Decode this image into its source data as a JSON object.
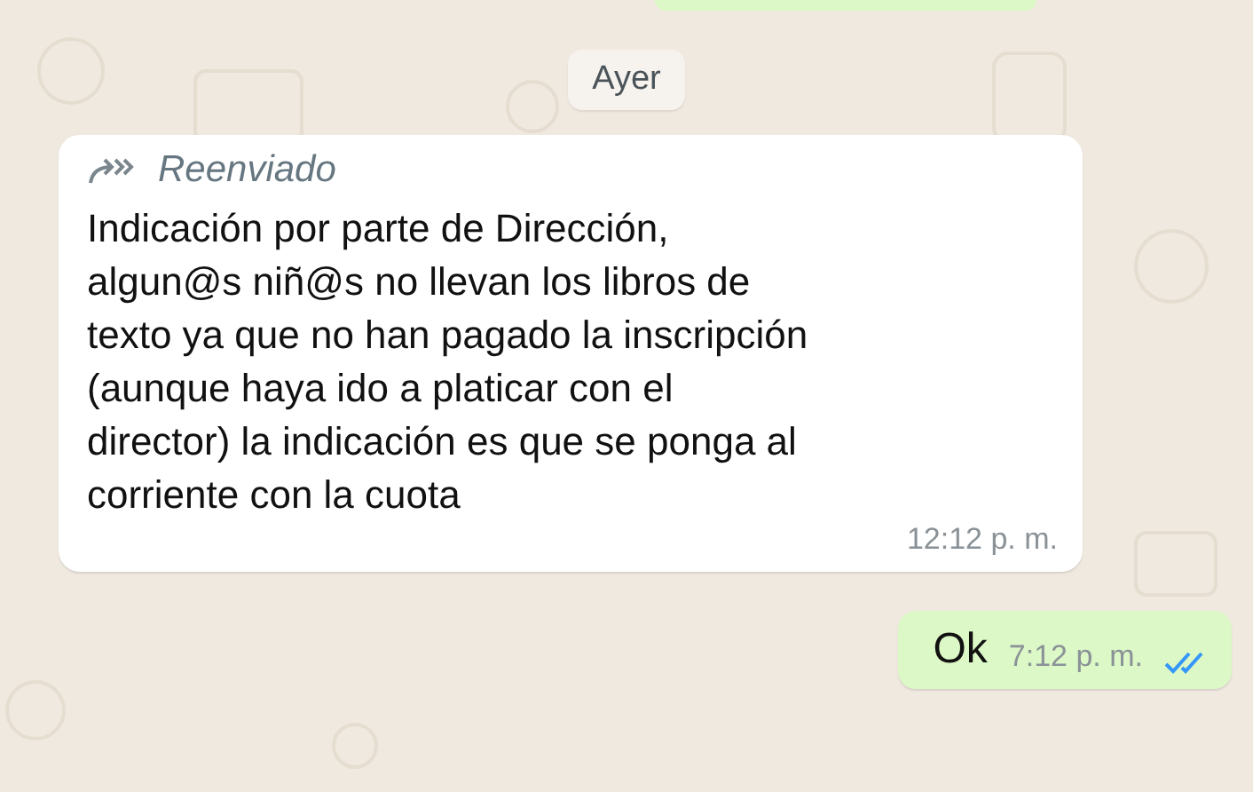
{
  "date_chip": "Ayer",
  "messages": [
    {
      "kind": "incoming",
      "forwarded": true,
      "forwarded_label": "Reenviado",
      "text_lines": [
        "Indicación por parte de Dirección,",
        "algun@s niñ@s no llevan los libros de",
        "texto ya que no han pagado la inscripción",
        "(aunque haya ido a platicar con el",
        "director) la indicación es que se ponga al",
        "corriente con la cuota"
      ],
      "time": "12:12 p. m."
    },
    {
      "kind": "outgoing",
      "text": "Ok",
      "time": "7:12 p. m.",
      "read": true
    }
  ]
}
